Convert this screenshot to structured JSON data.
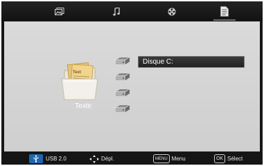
{
  "tabs": [
    {
      "icon": "photo-icon",
      "label": ""
    },
    {
      "icon": "music-note-icon",
      "label": ""
    },
    {
      "icon": "film-reel-icon",
      "label": ""
    },
    {
      "icon": "text-document-icon",
      "label": "",
      "selected": true
    }
  ],
  "media": {
    "label": "Texte",
    "folder_icon_text": "Text",
    "icon": "text-folder-icon"
  },
  "drives": {
    "count_icons": 4,
    "items": [
      {
        "label": "Disque C:",
        "selected": true
      }
    ]
  },
  "footer": {
    "usb_label": "USB 2.0",
    "nav_label": "Dépl.",
    "menu_key": "MENU",
    "menu_label": "Menu",
    "ok_key": "OK",
    "ok_label": "Sélect"
  },
  "colors": {
    "frame": "#171717",
    "content": "#d5d5d5",
    "usb_badge": "#1e67b0",
    "selected_item": "#2a2a2a"
  }
}
